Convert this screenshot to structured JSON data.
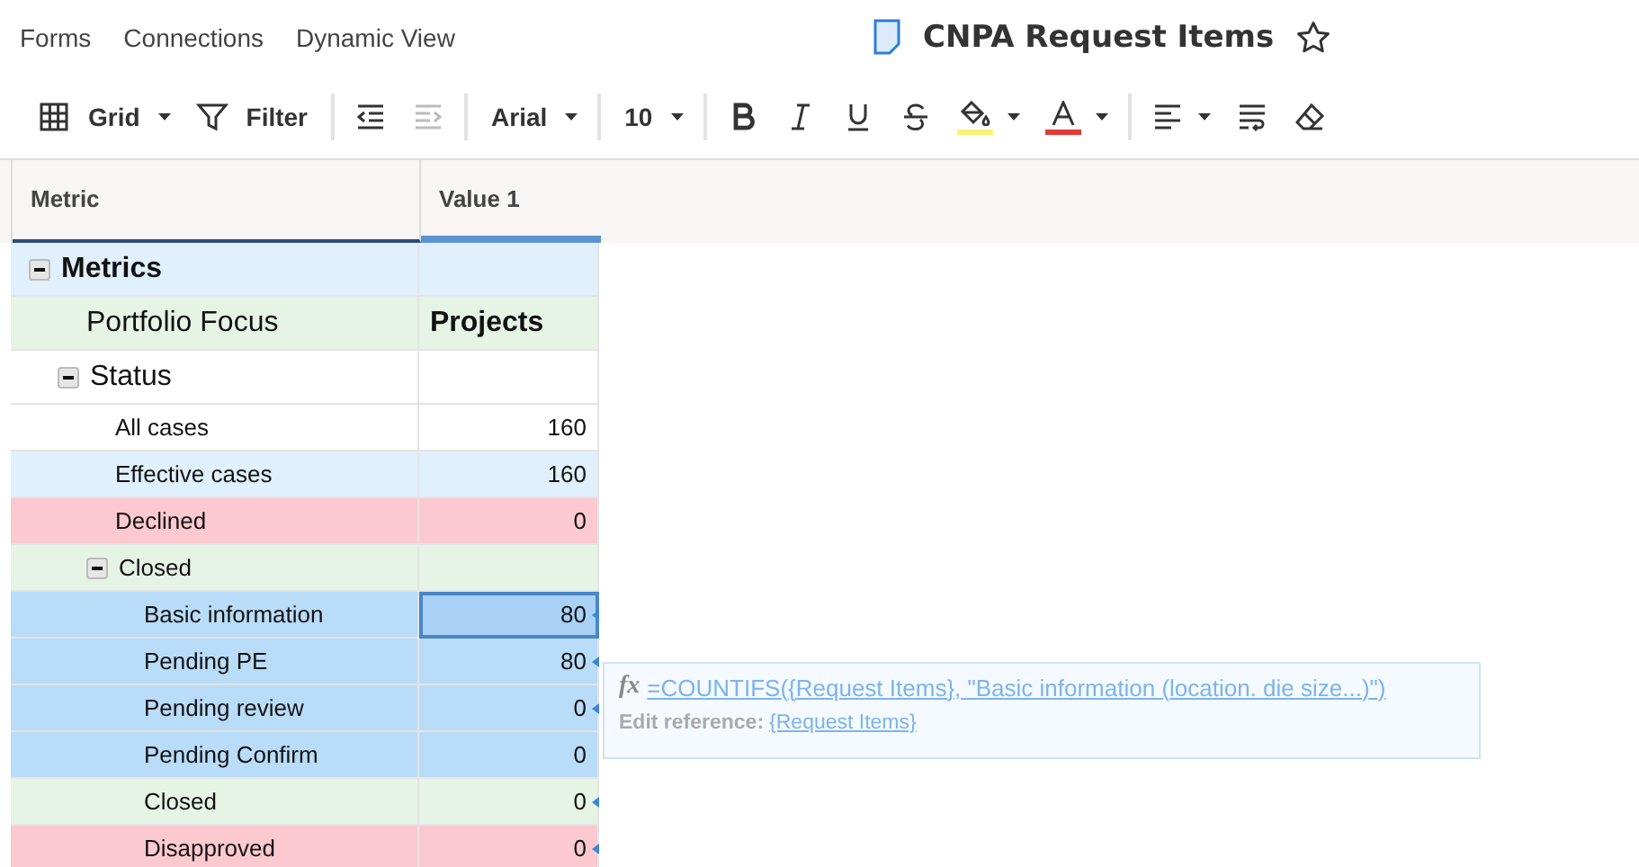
{
  "nav": [
    {
      "label": "Forms"
    },
    {
      "label": "Connections"
    },
    {
      "label": "Dynamic View"
    }
  ],
  "title": {
    "text": "CNPA Request Items",
    "starred": false
  },
  "toolbar": [
    [
      {
        "kind": "grid",
        "label": "Grid",
        "caret": true
      },
      {
        "kind": "filter",
        "label": "Filter",
        "caret": false
      }
    ],
    [
      {
        "kind": "outdent",
        "disabled": false
      },
      {
        "kind": "indent",
        "disabled": true
      }
    ],
    [
      {
        "kind": "font",
        "label": "Arial",
        "caret": true
      }
    ],
    [
      {
        "kind": "size",
        "label": "10",
        "caret": true
      }
    ],
    [
      {
        "kind": "bold"
      },
      {
        "kind": "italic"
      },
      {
        "kind": "underline"
      },
      {
        "kind": "strike"
      },
      {
        "kind": "fill",
        "color": "#fff176",
        "caret": true
      },
      {
        "kind": "textcolor",
        "color": "#e53935",
        "caret": true
      }
    ],
    [
      {
        "kind": "align",
        "caret": true
      },
      {
        "kind": "wrap"
      },
      {
        "kind": "eraser"
      }
    ]
  ],
  "table": {
    "columns": [
      {
        "label": "Metric",
        "selected": false
      },
      {
        "label": "Value 1",
        "selected": true
      }
    ],
    "rows": [
      {
        "kind": "section",
        "label": "Metrics",
        "color": "#e0f0fd",
        "expanded": true,
        "selected": false,
        "referenced": false,
        "children": [
          {
            "kind": "large",
            "label": "Portfolio Focus",
            "value": "Projects",
            "color": "#e6f4e6",
            "selected": false,
            "referenced": false
          },
          {
            "kind": "large",
            "label": "Status",
            "color": "#ffffff",
            "expanded": true,
            "selected": false,
            "referenced": false,
            "children": [
              {
                "kind": "item",
                "label": "All cases",
                "value": "160",
                "color": "#ffffff",
                "selected": false,
                "referenced": false
              },
              {
                "kind": "item",
                "label": "Effective cases",
                "value": "160",
                "color": "#e0f0fd",
                "selected": false,
                "referenced": false
              },
              {
                "kind": "item",
                "label": "Declined",
                "value": "0",
                "color": "#fcc9d0",
                "selected": false,
                "referenced": false
              },
              {
                "kind": "item",
                "label": "Closed",
                "color": "#e6f4e6",
                "expanded": true,
                "selected": false,
                "referenced": false,
                "children": [
                  {
                    "kind": "item",
                    "label": "Basic information",
                    "value": "80",
                    "color": "#b9dcf8",
                    "selected": true,
                    "referenced": true
                  },
                  {
                    "kind": "item",
                    "label": "Pending PE",
                    "value": "80",
                    "color": "#b9dcf8",
                    "selected": false,
                    "referenced": true
                  },
                  {
                    "kind": "item",
                    "label": "Pending review",
                    "value": "0",
                    "color": "#b9dcf8",
                    "selected": false,
                    "referenced": true
                  },
                  {
                    "kind": "item",
                    "label": "Pending Confirm",
                    "value": "0",
                    "color": "#b9dcf8",
                    "selected": false,
                    "referenced": false
                  },
                  {
                    "kind": "item",
                    "label": "Closed",
                    "value": "0",
                    "color": "#e6f4e6",
                    "selected": false,
                    "referenced": true
                  },
                  {
                    "kind": "item",
                    "label": "Disapproved",
                    "value": "0",
                    "color": "#fcc9d0",
                    "selected": false,
                    "referenced": true
                  }
                ]
              }
            ]
          }
        ]
      }
    ]
  },
  "formula_tooltip": {
    "fx_symbol": "fx",
    "formula": "=COUNTIFS({Request Items}, \"Basic information (location. die size...)\")",
    "edit_label": "Edit reference:",
    "reference": "{Request Items}"
  }
}
